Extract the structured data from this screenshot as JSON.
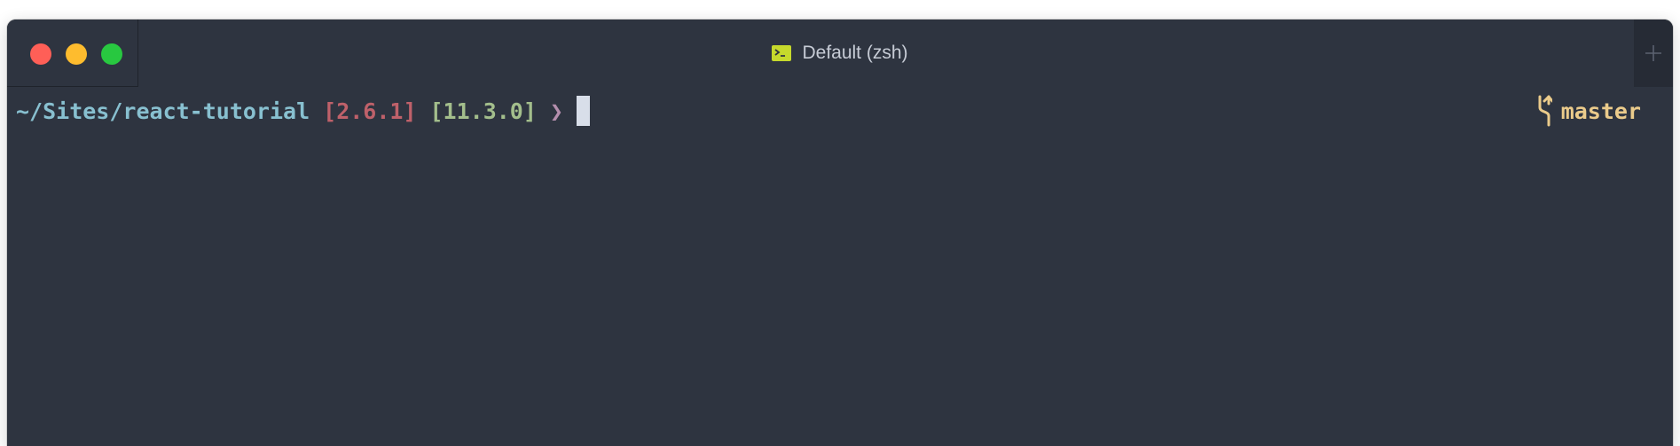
{
  "window": {
    "tab_title": "Default (zsh)",
    "tab_icon": "terminal-icon",
    "new_tab_icon": "plus-icon"
  },
  "prompt": {
    "path": "~/Sites/react-tutorial",
    "ruby_version": "[2.6.1]",
    "node_version": "[11.3.0]",
    "arrow": "❯"
  },
  "git": {
    "icon": "git-branch-icon",
    "branch": "master"
  },
  "colors": {
    "background": "#2e3440",
    "path": "#88c0d0",
    "ruby": "#bf616a",
    "node": "#a3be8c",
    "arrow": "#b48ead",
    "branch": "#ebcb8b",
    "tab_icon": "#c6d92c"
  }
}
